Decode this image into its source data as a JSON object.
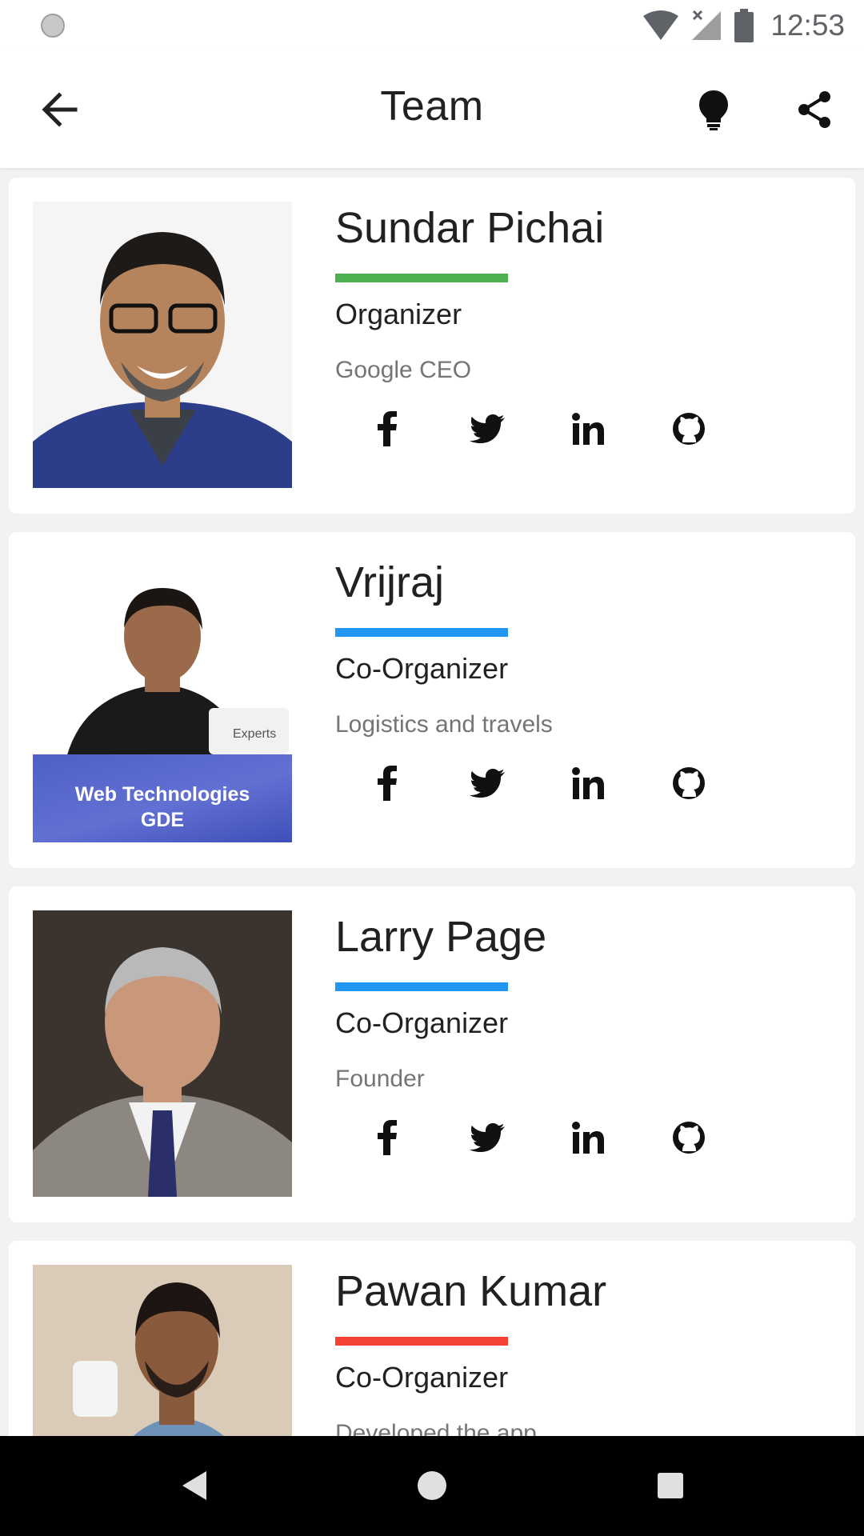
{
  "status": {
    "time": "12:53"
  },
  "app_bar": {
    "title": "Team"
  },
  "members": [
    {
      "name": "Sundar Pichai",
      "role": "Organizer",
      "desc": "Google CEO",
      "accent": "#4caf50"
    },
    {
      "name": "Vrijraj",
      "role": "Co-Organizer",
      "desc": "Logistics and travels",
      "accent": "#2196f3",
      "photo_banner": "Web Technologies\nGDE",
      "photo_badge": "Experts"
    },
    {
      "name": "Larry Page",
      "role": "Co-Organizer",
      "desc": "Founder",
      "accent": "#2196f3"
    },
    {
      "name": "Pawan Kumar",
      "role": "Co-Organizer",
      "desc": "Developed the app",
      "accent": "#f44336"
    }
  ],
  "social_icons": [
    "facebook-icon",
    "twitter-icon",
    "linkedin-icon",
    "github-icon"
  ],
  "nav": {
    "back": "back-triangle-icon",
    "home": "home-circle-icon",
    "recents": "recents-square-icon"
  }
}
